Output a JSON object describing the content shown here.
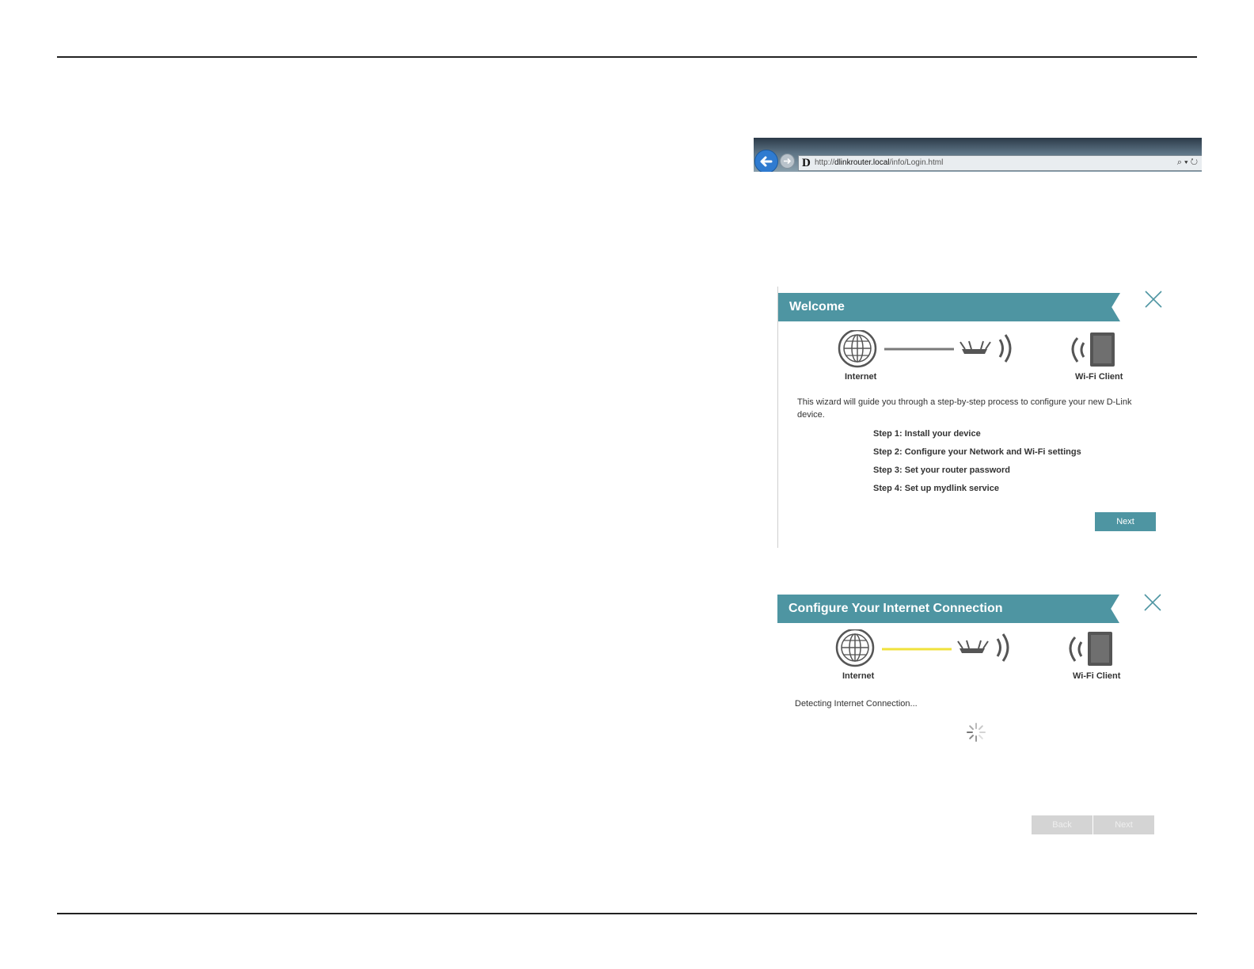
{
  "browser": {
    "logo": "D",
    "url_prefix": "http://",
    "url_host": "dlinkrouter.local",
    "url_path": "/info/Login.html",
    "icons": "⌕ ▾ ↻"
  },
  "welcome": {
    "title": "Welcome",
    "internet_label": "Internet",
    "client_label": "Wi-Fi Client",
    "intro": "This wizard will guide you through a step-by-step process to configure your new D-Link device.",
    "steps": [
      "Step 1: Install your device",
      "Step 2: Configure your Network and Wi-Fi settings",
      "Step 3: Set your router password",
      "Step 4: Set up mydlink service"
    ],
    "next_label": "Next",
    "line_color": "#7a7a7a"
  },
  "configure": {
    "title": "Configure Your Internet Connection",
    "internet_label": "Internet",
    "client_label": "Wi-Fi Client",
    "status": "Detecting Internet Connection...",
    "back_label": "Back",
    "next_label": "Next",
    "line_color": "#f0e23c"
  },
  "colors": {
    "accent": "#4e95a2",
    "disabled": "#d4d4d4"
  }
}
